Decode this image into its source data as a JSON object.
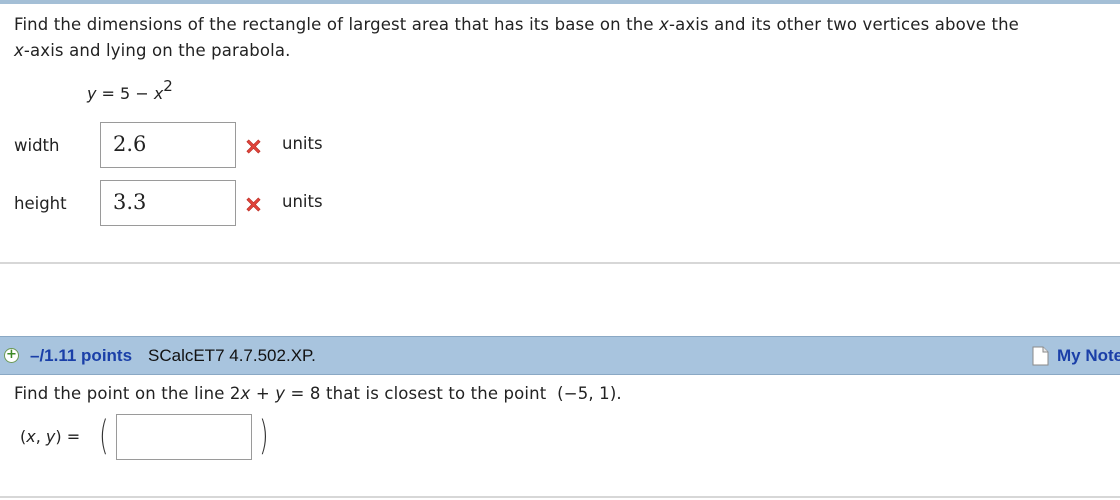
{
  "question1": {
    "text_part1": "Find the dimensions of the rectangle of largest area that has its base on the ",
    "x_axis_italic": "x",
    "text_part2": "-axis and its other two vertices above the ",
    "x_axis_italic2": "x",
    "text_part3": "-axis and lying on the parabola.",
    "equation_lhs": "y",
    "equation_mid": " = 5 − ",
    "equation_var": "x",
    "equation_exp": "2",
    "width_label": "width",
    "width_value": "2.6",
    "height_label": "height",
    "height_value": "3.3",
    "units_label": "units",
    "status": "incorrect"
  },
  "question2": {
    "points": "–/1.11 points",
    "source": "SCalcET7 4.7.502.XP.",
    "my_notes": "My Note",
    "text_part1": "Find the point on the line 2",
    "var_x": "x",
    "text_plus": " + ",
    "var_y": "y",
    "text_part2": " = 8 that is closest to the point",
    "point": "(−5, 1).",
    "xy_prefix": "(",
    "xy_x": "x",
    "xy_comma": ", ",
    "xy_y": "y",
    "xy_suffix": ") =",
    "open_paren": "(",
    "close_paren": ")",
    "answer_value": ""
  },
  "colors": {
    "header_bg": "#a8c4de",
    "link_blue": "#1a3fa8",
    "error_red": "#e0433a"
  }
}
